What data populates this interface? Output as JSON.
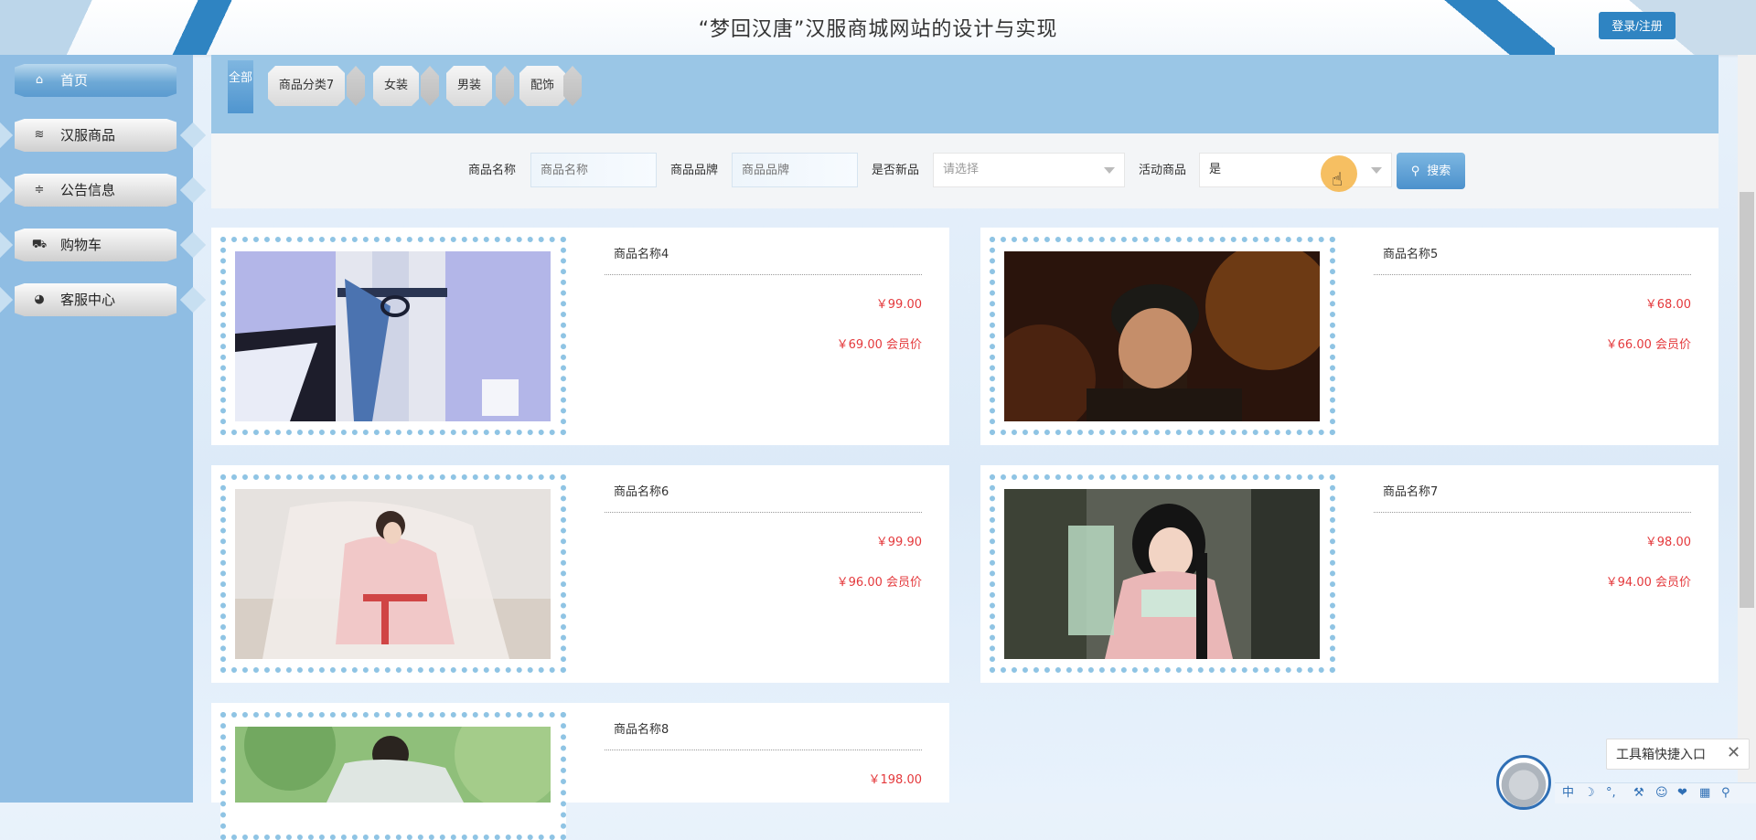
{
  "header": {
    "title": "“梦回汉唐”汉服商城网站的设计与实现",
    "login_label": "登录/注册"
  },
  "sidebar": {
    "items": [
      {
        "label": "首页",
        "icon": "home-icon",
        "glyph": "⌂",
        "active": true
      },
      {
        "label": "汉服商品",
        "icon": "layers-icon",
        "glyph": "≋",
        "active": false
      },
      {
        "label": "公告信息",
        "icon": "sliders-icon",
        "glyph": "≑",
        "active": false
      },
      {
        "label": "购物车",
        "icon": "cart-icon",
        "glyph": "⛟",
        "active": false
      },
      {
        "label": "客服中心",
        "icon": "service-icon",
        "glyph": "◕",
        "active": false
      }
    ]
  },
  "categories": {
    "all": "全部",
    "tabs": [
      "商品分类7",
      "女装",
      "男装",
      "配饰"
    ]
  },
  "search": {
    "name_label": "商品名称",
    "name_placeholder": "商品名称",
    "brand_label": "商品品牌",
    "brand_placeholder": "商品品牌",
    "new_label": "是否新品",
    "new_value": "请选择",
    "activity_label": "活动商品",
    "activity_value": "是",
    "button_label": "搜索",
    "button_icon": "magnifier-icon"
  },
  "products": [
    {
      "name": "商品名称4",
      "price": "￥99.00",
      "member_price": "￥69.00 会员价"
    },
    {
      "name": "商品名称5",
      "price": "￥68.00",
      "member_price": "￥66.00 会员价"
    },
    {
      "name": "商品名称6",
      "price": "￥99.90",
      "member_price": "￥96.00 会员价"
    },
    {
      "name": "商品名称7",
      "price": "￥98.00",
      "member_price": "￥94.00 会员价"
    },
    {
      "name": "商品名称8",
      "price": "￥198.00",
      "member_price": ""
    }
  ],
  "toolbox": {
    "label": "工具箱快捷入口",
    "close": "✕"
  },
  "ime": [
    "中",
    "☽",
    "°,",
    "⚒",
    "☺",
    "❤",
    "▦",
    "⚲"
  ],
  "colors": {
    "accent": "#2f84c2",
    "price": "#e4393c",
    "sidebar_bg": "#8fbde3",
    "category_band": "#9ac6e6"
  }
}
